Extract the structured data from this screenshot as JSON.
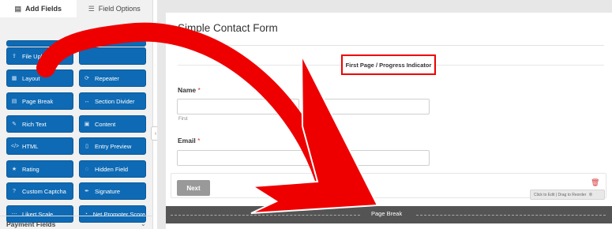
{
  "tabs": [
    {
      "label": "Add Fields",
      "icon": "list-icon",
      "active": true
    },
    {
      "label": "Field Options",
      "icon": "sliders-icon",
      "active": false
    }
  ],
  "fields": [
    {
      "label": "File Upload",
      "icon": "upload-icon",
      "glyph": "⇪"
    },
    {
      "label": "",
      "icon": "",
      "glyph": ""
    },
    {
      "label": "Layout",
      "icon": "layout-icon",
      "glyph": "▦"
    },
    {
      "label": "Repeater",
      "icon": "repeater-icon",
      "glyph": "⟳"
    },
    {
      "label": "Page Break",
      "icon": "page-break-icon",
      "glyph": "▤"
    },
    {
      "label": "Section Divider",
      "icon": "section-divider-icon",
      "glyph": "↔"
    },
    {
      "label": "Rich Text",
      "icon": "rich-text-icon",
      "glyph": "✎"
    },
    {
      "label": "Content",
      "icon": "content-icon",
      "glyph": "▣"
    },
    {
      "label": "HTML",
      "icon": "code-icon",
      "glyph": "</>"
    },
    {
      "label": "Entry Preview",
      "icon": "file-icon",
      "glyph": "▯"
    },
    {
      "label": "Rating",
      "icon": "star-icon",
      "glyph": "★"
    },
    {
      "label": "Hidden Field",
      "icon": "eye-slash-icon",
      "glyph": "◌"
    },
    {
      "label": "Custom Captcha",
      "icon": "question-icon",
      "glyph": "?"
    },
    {
      "label": "Signature",
      "icon": "pen-icon",
      "glyph": "✒"
    },
    {
      "label": "Likert Scale",
      "icon": "dots-icon",
      "glyph": "⋯"
    },
    {
      "label": "Net Promoter Score",
      "icon": "gauge-icon",
      "glyph": "◔"
    }
  ],
  "payment_section": {
    "title": "Payment Fields",
    "chevron": "⌄"
  },
  "form": {
    "title": "Simple Contact Form",
    "progress_indicator": "First Page / Progress Indicator",
    "name_label": "Name",
    "email_label": "Email",
    "required_mark": "*",
    "first_sub": "First",
    "last_sub": "Last",
    "next_label": "Next",
    "edit_hint": "Click to Edit | Drag to Reorder",
    "page_break_label": "Page Break"
  },
  "colors": {
    "field_button": "#0e6ab4",
    "highlight_box": "#ee0000",
    "arrow": "#ee0000",
    "page_break_bar": "#545454"
  }
}
